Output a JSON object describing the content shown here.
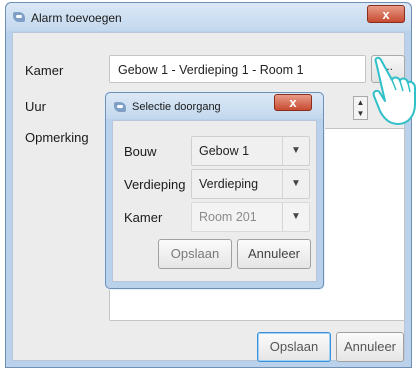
{
  "main": {
    "title": "Alarm toevoegen",
    "close_label": "x",
    "kamer_label": "Kamer",
    "kamer_value": "Gebow 1 - Verdieping 1 - Room 1",
    "browse_label": "...",
    "uur_label": "Uur",
    "opmerking_label": "Opmerking",
    "spinner_up": "▲",
    "spinner_down": "▼",
    "save_label": "Opslaan",
    "cancel_label": "Annuleer"
  },
  "dialog": {
    "title": "Selectie doorgang",
    "close_label": "x",
    "bouw_label": "Bouw",
    "bouw_value": "Gebow 1",
    "verdieping_label": "Verdieping",
    "verdieping_value": "Verdieping",
    "kamer_label": "Kamer",
    "kamer_value": "Room 201",
    "arrow": "▼",
    "save_label": "Opslaan",
    "cancel_label": "Annuleer"
  },
  "colors": {
    "frame": "#b9d1ea",
    "close_button": "#c74b32",
    "focus_border": "#3c8fd8",
    "hand_pointer": "#2fc0c8"
  },
  "icons": [
    "window-app-icon",
    "dialog-app-icon",
    "pointing-hand-icon"
  ]
}
